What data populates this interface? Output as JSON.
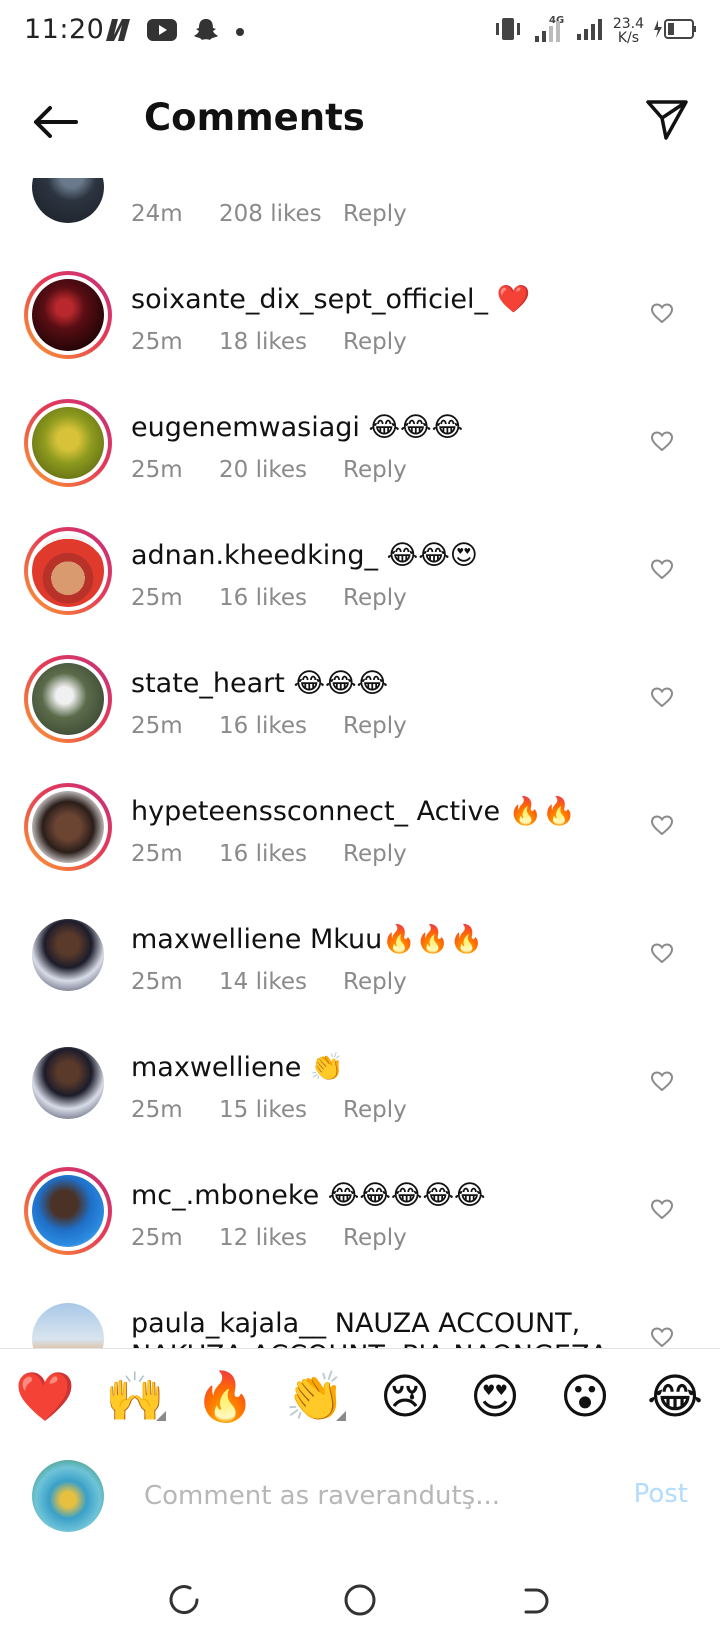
{
  "status_bar": {
    "time": "11:20",
    "network_type": "4G",
    "speed_value": "23.4",
    "speed_unit": "K/s"
  },
  "header": {
    "title": "Comments",
    "back_icon": "arrow-left-icon",
    "share_icon": "paper-plane-icon"
  },
  "partial_comment": {
    "time": "24m",
    "likes": "208 likes",
    "reply": "Reply"
  },
  "comments": [
    {
      "user": "soixante_dix_sept_officiel_",
      "text": "❤️",
      "time": "25m",
      "likes": "18 likes",
      "reply": "Reply",
      "story_ring": true
    },
    {
      "user": "eugenemwasiagi",
      "text": "😂😂😂",
      "time": "25m",
      "likes": "20 likes",
      "reply": "Reply",
      "story_ring": true
    },
    {
      "user": "adnan.kheedking_",
      "text": "😂😂😍",
      "time": "25m",
      "likes": "16 likes",
      "reply": "Reply",
      "story_ring": true
    },
    {
      "user": "state_heart",
      "text": "😂😂😂",
      "time": "25m",
      "likes": "16 likes",
      "reply": "Reply",
      "story_ring": true
    },
    {
      "user": "hypeteenssconnect_",
      "text": "Active 🔥🔥",
      "time": "25m",
      "likes": "16 likes",
      "reply": "Reply",
      "story_ring": true
    },
    {
      "user": "maxwelliene",
      "text": "Mkuu🔥🔥🔥",
      "time": "25m",
      "likes": "14 likes",
      "reply": "Reply",
      "story_ring": false
    },
    {
      "user": "maxwelliene",
      "text": "👏",
      "time": "25m",
      "likes": "15 likes",
      "reply": "Reply",
      "story_ring": false
    },
    {
      "user": "mc_.mboneke",
      "text": "😂😂😂😂😂",
      "time": "25m",
      "likes": "12 likes",
      "reply": "Reply",
      "story_ring": true
    },
    {
      "user": "paula_kajala__",
      "text": "NAUZA ACCOUNT, NAKUZA ACCOUNT ,PIA NAONGEZA",
      "time": "",
      "likes": "",
      "reply": "",
      "story_ring": false
    }
  ],
  "reactions": [
    "❤️",
    "🙌",
    "🔥",
    "👏",
    "😢",
    "😍",
    "😮",
    "😂"
  ],
  "composer": {
    "placeholder": "Comment as raverandutş...",
    "post_label": "Post"
  },
  "colors": {
    "meta_text": "#8a8a8a",
    "post_disabled": "#b3dbff",
    "story_ring_start": "#f9a132",
    "story_ring_end": "#c2307f"
  }
}
